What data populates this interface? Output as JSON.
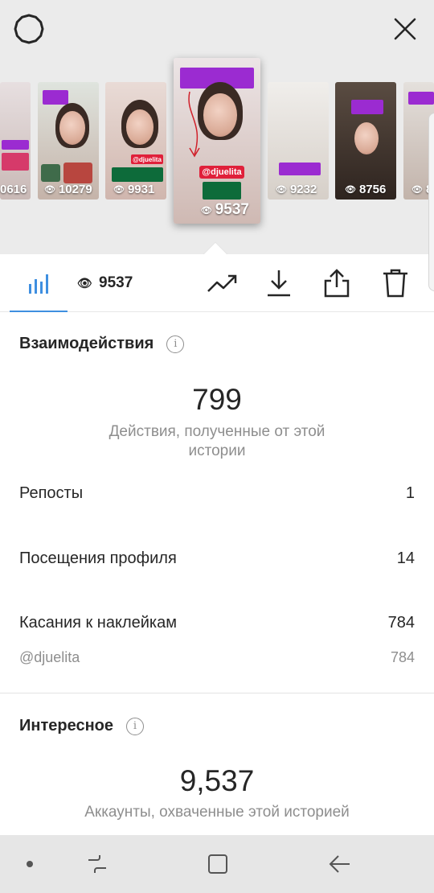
{
  "header": {
    "settings_icon": "settings-icon",
    "close_icon": "close-icon"
  },
  "stories": [
    {
      "views": "0616"
    },
    {
      "views": "10279"
    },
    {
      "views": "9931",
      "tag": "@djuelita"
    },
    {
      "views": "9537",
      "tag": "@djuelita",
      "selected": true
    },
    {
      "views": "9232"
    },
    {
      "views": "8756"
    },
    {
      "views": "8"
    }
  ],
  "toolbar": {
    "insights_icon": "bar-chart-icon",
    "views_icon": "eye-icon",
    "views_count": "9537",
    "promote_icon": "trending-icon",
    "download_icon": "download-icon",
    "share_icon": "share-icon",
    "delete_icon": "trash-icon"
  },
  "interactions": {
    "title": "Взаимодействия",
    "total": "799",
    "caption": "Действия, полученные от этой истории",
    "rows": [
      {
        "label": "Репосты",
        "value": "1"
      },
      {
        "label": "Посещения профиля",
        "value": "14"
      },
      {
        "label": "Касания к наклейкам",
        "value": "784"
      }
    ],
    "sub_row": {
      "label": "@djuelita",
      "value": "784"
    }
  },
  "discovery": {
    "title": "Интересное",
    "total": "9,537",
    "caption": "Аккаунты, охваченные этой историей"
  },
  "nav": {
    "dot_icon": "dot-icon",
    "recents_icon": "recents-icon",
    "home_icon": "home-icon",
    "back_icon": "back-icon"
  },
  "colors": {
    "accent": "#3f8fe0",
    "sticker_red": "#e0203a",
    "sticker_purple": "#9b2bd1",
    "sticker_green": "#0d6b3a"
  }
}
